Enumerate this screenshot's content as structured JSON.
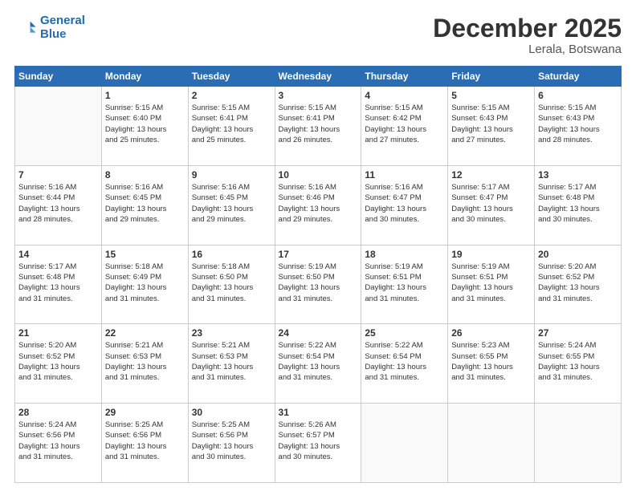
{
  "header": {
    "logo_line1": "General",
    "logo_line2": "Blue",
    "title": "December 2025",
    "subtitle": "Lerala, Botswana"
  },
  "weekdays": [
    "Sunday",
    "Monday",
    "Tuesday",
    "Wednesday",
    "Thursday",
    "Friday",
    "Saturday"
  ],
  "weeks": [
    [
      {
        "day": "",
        "info": ""
      },
      {
        "day": "1",
        "info": "Sunrise: 5:15 AM\nSunset: 6:40 PM\nDaylight: 13 hours\nand 25 minutes."
      },
      {
        "day": "2",
        "info": "Sunrise: 5:15 AM\nSunset: 6:41 PM\nDaylight: 13 hours\nand 25 minutes."
      },
      {
        "day": "3",
        "info": "Sunrise: 5:15 AM\nSunset: 6:41 PM\nDaylight: 13 hours\nand 26 minutes."
      },
      {
        "day": "4",
        "info": "Sunrise: 5:15 AM\nSunset: 6:42 PM\nDaylight: 13 hours\nand 27 minutes."
      },
      {
        "day": "5",
        "info": "Sunrise: 5:15 AM\nSunset: 6:43 PM\nDaylight: 13 hours\nand 27 minutes."
      },
      {
        "day": "6",
        "info": "Sunrise: 5:15 AM\nSunset: 6:43 PM\nDaylight: 13 hours\nand 28 minutes."
      }
    ],
    [
      {
        "day": "7",
        "info": "Sunrise: 5:16 AM\nSunset: 6:44 PM\nDaylight: 13 hours\nand 28 minutes."
      },
      {
        "day": "8",
        "info": "Sunrise: 5:16 AM\nSunset: 6:45 PM\nDaylight: 13 hours\nand 29 minutes."
      },
      {
        "day": "9",
        "info": "Sunrise: 5:16 AM\nSunset: 6:45 PM\nDaylight: 13 hours\nand 29 minutes."
      },
      {
        "day": "10",
        "info": "Sunrise: 5:16 AM\nSunset: 6:46 PM\nDaylight: 13 hours\nand 29 minutes."
      },
      {
        "day": "11",
        "info": "Sunrise: 5:16 AM\nSunset: 6:47 PM\nDaylight: 13 hours\nand 30 minutes."
      },
      {
        "day": "12",
        "info": "Sunrise: 5:17 AM\nSunset: 6:47 PM\nDaylight: 13 hours\nand 30 minutes."
      },
      {
        "day": "13",
        "info": "Sunrise: 5:17 AM\nSunset: 6:48 PM\nDaylight: 13 hours\nand 30 minutes."
      }
    ],
    [
      {
        "day": "14",
        "info": "Sunrise: 5:17 AM\nSunset: 6:48 PM\nDaylight: 13 hours\nand 31 minutes."
      },
      {
        "day": "15",
        "info": "Sunrise: 5:18 AM\nSunset: 6:49 PM\nDaylight: 13 hours\nand 31 minutes."
      },
      {
        "day": "16",
        "info": "Sunrise: 5:18 AM\nSunset: 6:50 PM\nDaylight: 13 hours\nand 31 minutes."
      },
      {
        "day": "17",
        "info": "Sunrise: 5:19 AM\nSunset: 6:50 PM\nDaylight: 13 hours\nand 31 minutes."
      },
      {
        "day": "18",
        "info": "Sunrise: 5:19 AM\nSunset: 6:51 PM\nDaylight: 13 hours\nand 31 minutes."
      },
      {
        "day": "19",
        "info": "Sunrise: 5:19 AM\nSunset: 6:51 PM\nDaylight: 13 hours\nand 31 minutes."
      },
      {
        "day": "20",
        "info": "Sunrise: 5:20 AM\nSunset: 6:52 PM\nDaylight: 13 hours\nand 31 minutes."
      }
    ],
    [
      {
        "day": "21",
        "info": "Sunrise: 5:20 AM\nSunset: 6:52 PM\nDaylight: 13 hours\nand 31 minutes."
      },
      {
        "day": "22",
        "info": "Sunrise: 5:21 AM\nSunset: 6:53 PM\nDaylight: 13 hours\nand 31 minutes."
      },
      {
        "day": "23",
        "info": "Sunrise: 5:21 AM\nSunset: 6:53 PM\nDaylight: 13 hours\nand 31 minutes."
      },
      {
        "day": "24",
        "info": "Sunrise: 5:22 AM\nSunset: 6:54 PM\nDaylight: 13 hours\nand 31 minutes."
      },
      {
        "day": "25",
        "info": "Sunrise: 5:22 AM\nSunset: 6:54 PM\nDaylight: 13 hours\nand 31 minutes."
      },
      {
        "day": "26",
        "info": "Sunrise: 5:23 AM\nSunset: 6:55 PM\nDaylight: 13 hours\nand 31 minutes."
      },
      {
        "day": "27",
        "info": "Sunrise: 5:24 AM\nSunset: 6:55 PM\nDaylight: 13 hours\nand 31 minutes."
      }
    ],
    [
      {
        "day": "28",
        "info": "Sunrise: 5:24 AM\nSunset: 6:56 PM\nDaylight: 13 hours\nand 31 minutes."
      },
      {
        "day": "29",
        "info": "Sunrise: 5:25 AM\nSunset: 6:56 PM\nDaylight: 13 hours\nand 31 minutes."
      },
      {
        "day": "30",
        "info": "Sunrise: 5:25 AM\nSunset: 6:56 PM\nDaylight: 13 hours\nand 30 minutes."
      },
      {
        "day": "31",
        "info": "Sunrise: 5:26 AM\nSunset: 6:57 PM\nDaylight: 13 hours\nand 30 minutes."
      },
      {
        "day": "",
        "info": ""
      },
      {
        "day": "",
        "info": ""
      },
      {
        "day": "",
        "info": ""
      }
    ]
  ]
}
